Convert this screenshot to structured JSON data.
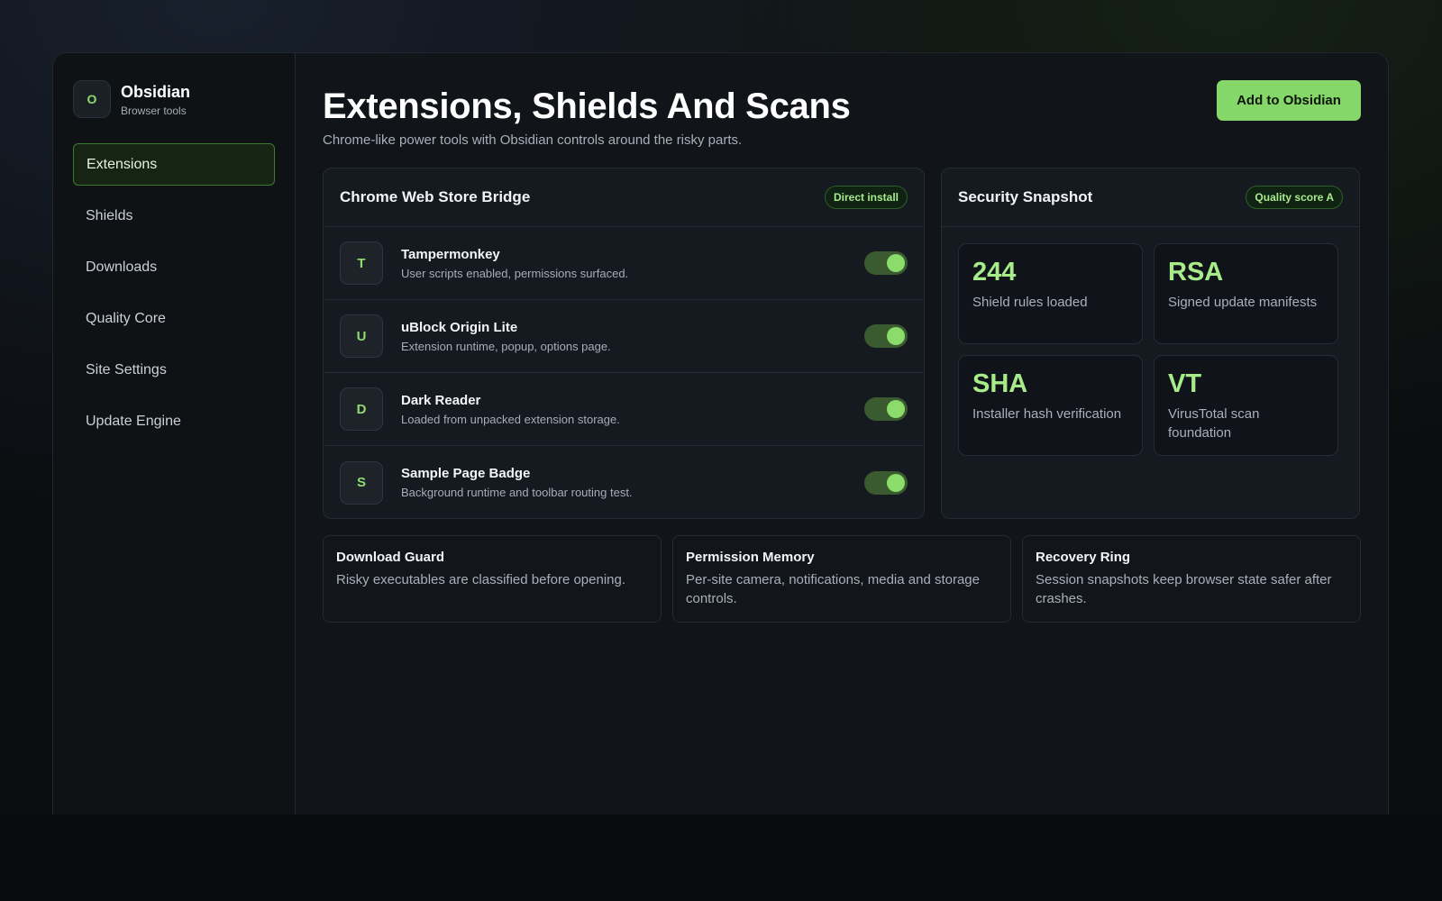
{
  "brand": {
    "logo_letter": "O",
    "name": "Obsidian",
    "subtitle": "Browser tools"
  },
  "sidebar": {
    "items": [
      {
        "label": "Extensions",
        "active": true
      },
      {
        "label": "Shields",
        "active": false
      },
      {
        "label": "Downloads",
        "active": false
      },
      {
        "label": "Quality Core",
        "active": false
      },
      {
        "label": "Site Settings",
        "active": false
      },
      {
        "label": "Update Engine",
        "active": false
      }
    ]
  },
  "header": {
    "title": "Extensions, Shields And Scans",
    "subtitle": "Chrome-like power tools with Obsidian controls around the risky parts.",
    "primary_button": "Add to Obsidian"
  },
  "bridge": {
    "title": "Chrome Web Store Bridge",
    "badge": "Direct install",
    "extensions": [
      {
        "letter": "T",
        "name": "Tampermonkey",
        "description": "User scripts enabled, permissions surfaced.",
        "enabled": true
      },
      {
        "letter": "U",
        "name": "uBlock Origin Lite",
        "description": "Extension runtime, popup, options page.",
        "enabled": true
      },
      {
        "letter": "D",
        "name": "Dark Reader",
        "description": "Loaded from unpacked extension storage.",
        "enabled": true
      },
      {
        "letter": "S",
        "name": "Sample Page Badge",
        "description": "Background runtime and toolbar routing test.",
        "enabled": true
      }
    ]
  },
  "snapshot": {
    "title": "Security Snapshot",
    "badge": "Quality score A",
    "stats": [
      {
        "value": "244",
        "label": "Shield rules loaded"
      },
      {
        "value": "RSA",
        "label": "Signed update manifests"
      },
      {
        "value": "SHA",
        "label": "Installer hash verification"
      },
      {
        "value": "VT",
        "label": "VirusTotal scan foundation"
      }
    ]
  },
  "features": [
    {
      "title": "Download Guard",
      "text": "Risky executables are classified before opening."
    },
    {
      "title": "Permission Memory",
      "text": "Per-site camera, notifications, media and storage controls."
    },
    {
      "title": "Recovery Ring",
      "text": "Session snapshots keep browser state safer after crashes."
    }
  ],
  "colors": {
    "accent": "#86d76a",
    "background": "#111418"
  }
}
